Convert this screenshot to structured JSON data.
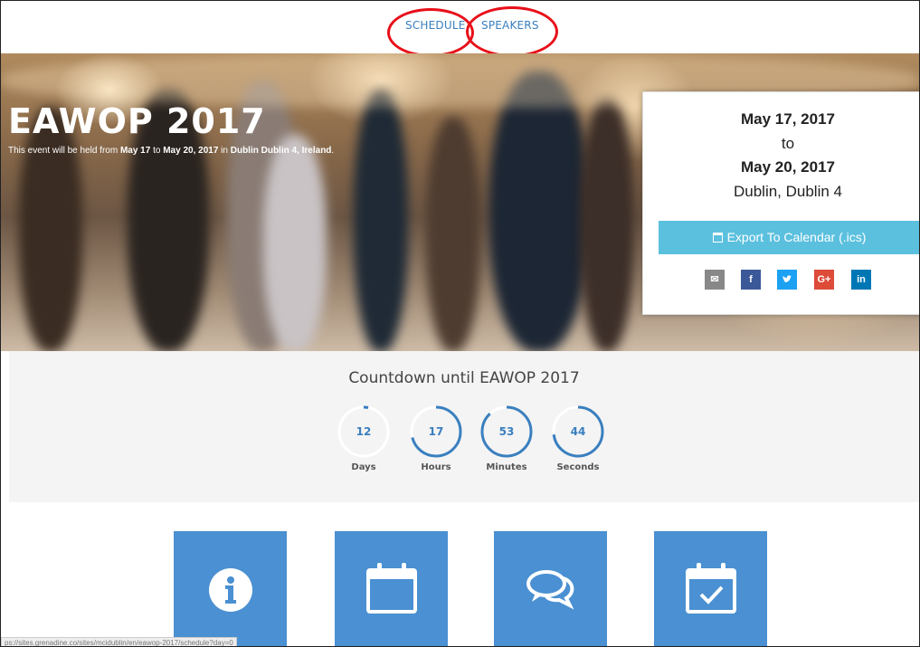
{
  "nav": {
    "schedule_label": "SCHEDULE",
    "speakers_label": "SPEAKERS"
  },
  "hero": {
    "title": "EAWOP 2017",
    "sub_prefix": "This event will be held from ",
    "sub_start": "May 17",
    "sub_to": " to ",
    "sub_end": "May 20, 2017",
    "sub_in": " in ",
    "sub_location": "Dublin Dublin 4, Ireland",
    "sub_end_punct": "."
  },
  "card": {
    "start_date": "May 17, 2017",
    "to": "to",
    "end_date": "May 20, 2017",
    "location": "Dublin, Dublin 4",
    "export_label": "Export To Calendar (.ics)",
    "share": {
      "email_icon": "✉",
      "facebook": "f",
      "twitter_icon": "bird",
      "google_plus": "G+",
      "linkedin": "in"
    }
  },
  "countdown": {
    "title": "Countdown until EAWOP 2017",
    "timers": [
      {
        "value": "12",
        "label": "Days",
        "progress": 0.03
      },
      {
        "value": "17",
        "label": "Hours",
        "progress": 0.71
      },
      {
        "value": "53",
        "label": "Minutes",
        "progress": 0.88
      },
      {
        "value": "44",
        "label": "Seconds",
        "progress": 0.73
      }
    ]
  },
  "tiles": [
    {
      "icon": "info-icon"
    },
    {
      "icon": "calendar-icon"
    },
    {
      "icon": "speech-bubbles-icon"
    },
    {
      "icon": "calendar-check-icon"
    }
  ],
  "status_bar": {
    "url": "ps://sites.grenadine.co/sites/mcidublin/en/eawop-2017/schedule?day=0"
  },
  "colors": {
    "link": "#3a7fbf",
    "annotation_ring": "#e8101a",
    "export_button": "#5bc0de",
    "tile": "#4a90d2"
  }
}
